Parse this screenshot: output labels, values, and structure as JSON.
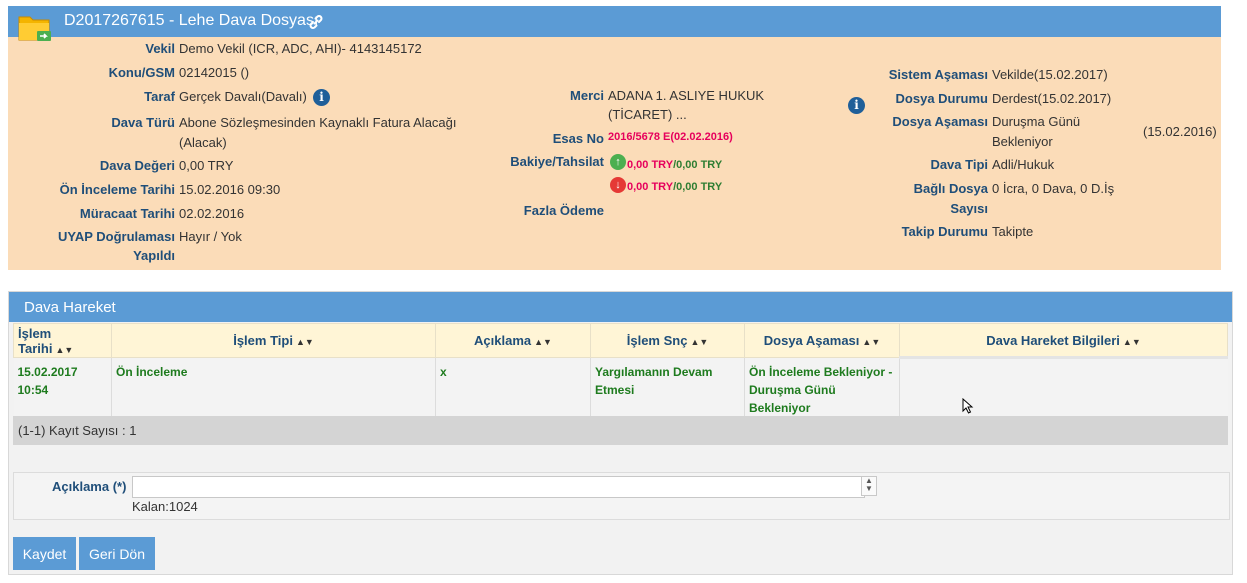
{
  "header": {
    "title": "D2017267615 - Lehe Dava Dosyası"
  },
  "left": {
    "vekil": {
      "label": "Vekil",
      "value": "Demo Vekil  (ICR, ADC, AHI)- 4143145172"
    },
    "konu": {
      "label": "Konu/GSM",
      "value": "02142015 ()"
    },
    "taraf": {
      "label": "Taraf",
      "value": "Gerçek Davalı(Davalı)"
    },
    "dava_turu": {
      "label": "Dava Türü",
      "value_line1": "Abone Sözleşmesinden Kaynaklı Fatura Alacağı",
      "value_line2": "(Alacak)"
    },
    "dava_degeri": {
      "label": "Dava Değeri",
      "value": "0,00 TRY"
    },
    "on_inceleme": {
      "label": "Ön İnceleme Tarihi",
      "value": "15.02.2016 09:30"
    },
    "muracaat": {
      "label": "Müracaat Tarihi",
      "value": "02.02.2016"
    },
    "uyap": {
      "label_line1": "UYAP Doğrulaması",
      "label_line2": "Yapıldı",
      "value": "Hayır / Yok"
    }
  },
  "middle": {
    "merci": {
      "label": "Merci",
      "value_line1": "ADANA 1. ASLIYE HUKUK",
      "value_line2": "(TİCARET) ..."
    },
    "esas_no": {
      "label": "Esas No",
      "value": "2016/5678 E(02.02.2016)"
    },
    "bakiye": {
      "label": "Bakiye/Tahsilat",
      "row1_red": "0,00 TRY",
      "row1_green": "0,00 TRY",
      "row2_red": "0,00 TRY",
      "row2_green": "0,00 TRY",
      "separator": "/"
    },
    "fazla_odeme": {
      "label": "Fazla Ödeme"
    }
  },
  "right": {
    "sistem_asamasi": {
      "label": "Sistem Aşaması",
      "value": "Vekilde(15.02.2017)"
    },
    "dosya_durumu": {
      "label": "Dosya Durumu",
      "value": "Derdest(15.02.2017)"
    },
    "dosya_asamasi": {
      "label": "Dosya Aşaması",
      "value_line1": "Duruşma Günü",
      "value_line2": "Bekleniyor",
      "date": "(15.02.2016)"
    },
    "dava_tipi": {
      "label": "Dava Tipi",
      "value": "Adli/Hukuk"
    },
    "bagli_dosya": {
      "label_line1": "Bağlı Dosya",
      "label_line2": "Sayısı",
      "value": "0 İcra, 0 Dava, 0 D.İş"
    },
    "takip_durumu": {
      "label": "Takip Durumu",
      "value": "Takipte"
    }
  },
  "dava_hareket": {
    "title": "Dava Hareket",
    "columns": [
      "İşlem Tarihi",
      "İşlem Tipi",
      "Açıklama",
      "İşlem Snç",
      "Dosya Aşaması",
      "Dava Hareket Bilgileri"
    ],
    "rows": [
      {
        "tarih_line1": "15.02.2017",
        "tarih_line2": "10:54",
        "tip": "Ön İnceleme",
        "aciklama": "x",
        "snc_line1": "Yargılamanın Devam",
        "snc_line2": "Etmesi",
        "asama_line1": "Ön İnceleme Bekleniyor -",
        "asama_line2": "Duruşma Günü",
        "asama_line3": "Bekleniyor",
        "bilgi": ""
      }
    ],
    "record_count": "(1-1) Kayıt Sayısı : 1"
  },
  "form": {
    "label": "Açıklama (*)",
    "value": "",
    "remaining": "Kalan:1024"
  },
  "buttons": {
    "save": "Kaydet",
    "back": "Geri Dön"
  },
  "colors": {
    "header_blue": "#5b9bd5",
    "panel_bg": "#fbdcb8",
    "label_blue": "#1f4e79",
    "green_text": "#1e7b1e",
    "red_amount": "#e6005c"
  }
}
